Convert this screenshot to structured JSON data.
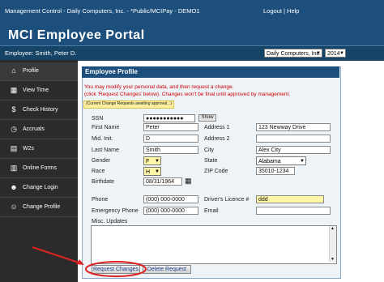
{
  "topbar": {
    "title": "Management Control - Daily Computers, Inc. - *Public/MCIPay - DEMO1",
    "links": "Logout | Help"
  },
  "banner": {
    "title": "MCI Employee Portal"
  },
  "employee_bar": {
    "employee": "Employee: Smith, Peter D.",
    "company_select": "Daily Computers, Inc.",
    "year_select": "2014"
  },
  "sidebar": {
    "items": [
      {
        "label": "Profile",
        "icon": "home-icon"
      },
      {
        "label": "View Time",
        "icon": "calendar-icon"
      },
      {
        "label": "Check History",
        "icon": "money-bag-icon"
      },
      {
        "label": "Accruals",
        "icon": "clock-icon"
      },
      {
        "label": "W2s",
        "icon": "document-icon"
      },
      {
        "label": "Online Forms",
        "icon": "forms-icon"
      },
      {
        "label": "Change Login",
        "icon": "user-icon"
      },
      {
        "label": "Change Profile",
        "icon": "users-icon"
      }
    ]
  },
  "profile": {
    "heading": "Employee Profile",
    "message1": "You may modify your personal data, and then request a change.",
    "message2": "(click 'Request Changes' below). Changes won't be final until approved by management.",
    "pending_note": "(Current Change Requests awaiting approval...)",
    "labels": {
      "ssn": "SSN",
      "first_name": "First Name",
      "mid_init": "Mid. Init.",
      "last_name": "Last Name",
      "gender": "Gender",
      "race": "Race",
      "birthdate": "Birthdate",
      "address1": "Address 1",
      "address2": "Address 2",
      "city": "City",
      "state": "State",
      "zip": "ZIP Code",
      "phone": "Phone",
      "emergency_phone": "Emergency Phone",
      "drivers_licence": "Driver's Licence #",
      "email": "Email",
      "misc_updates": "Misc. Updates"
    },
    "values": {
      "ssn": "●●●●●●●●●●●",
      "first_name": "Peter",
      "mid_init": "D",
      "last_name": "Smith",
      "gender": "F",
      "race": "H",
      "birthdate": "08/31/1964",
      "address1": "123 Newway Drive",
      "address2": "",
      "city": "Alex City",
      "state": "Alabama",
      "zip": "35010-1234",
      "phone": "(000) 000-0000",
      "emergency_phone": "(000) 000-0000",
      "drivers_licence": "ddd",
      "email": "",
      "misc_updates": ""
    },
    "show_label": "Show",
    "request_changes": "Request Changes",
    "delete_request": "Delete Request"
  }
}
